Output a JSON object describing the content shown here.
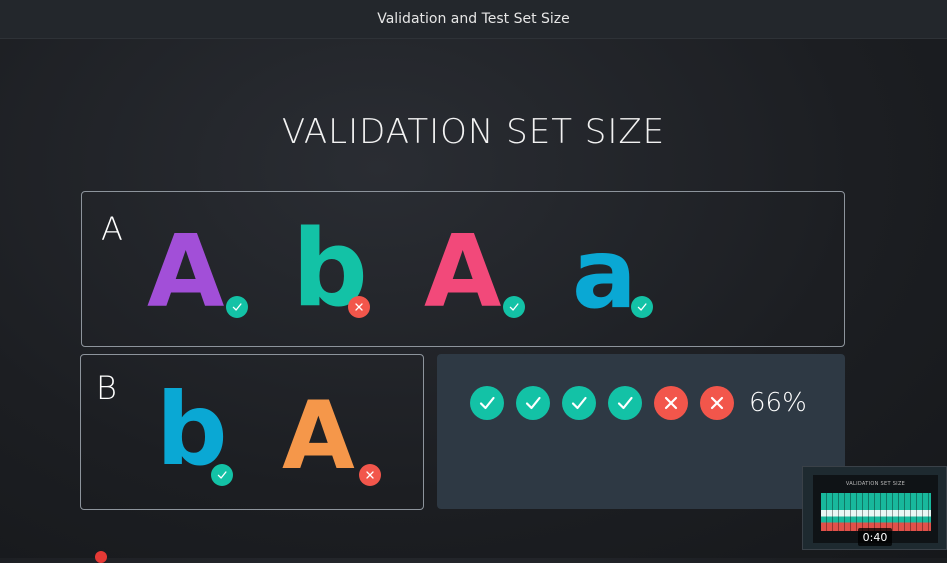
{
  "window": {
    "title": "Validation and Test Set Size"
  },
  "slide": {
    "title": "VALIDATION SET SIZE",
    "box_a": {
      "label": "A",
      "items": [
        {
          "char": "A",
          "color": "#a24fd8",
          "status": "check"
        },
        {
          "char": "b",
          "color": "#13c2a6",
          "status": "cross"
        },
        {
          "char": "A",
          "color": "#f2497a",
          "status": "check"
        },
        {
          "char": "a",
          "color": "#0aa8d4",
          "status": "check"
        }
      ]
    },
    "box_b": {
      "label": "B",
      "items": [
        {
          "char": "b",
          "color": "#0aa8d4",
          "status": "check"
        },
        {
          "char": "A",
          "color": "#f5974a",
          "status": "cross"
        }
      ]
    },
    "result": {
      "marks": [
        "check",
        "check",
        "check",
        "check",
        "cross",
        "cross"
      ],
      "percent": "66%"
    }
  },
  "thumbnail": {
    "title": "VALIDATION SET SIZE",
    "time": "0:40"
  },
  "colors": {
    "check": "#13c2a6",
    "cross": "#f2564b"
  }
}
